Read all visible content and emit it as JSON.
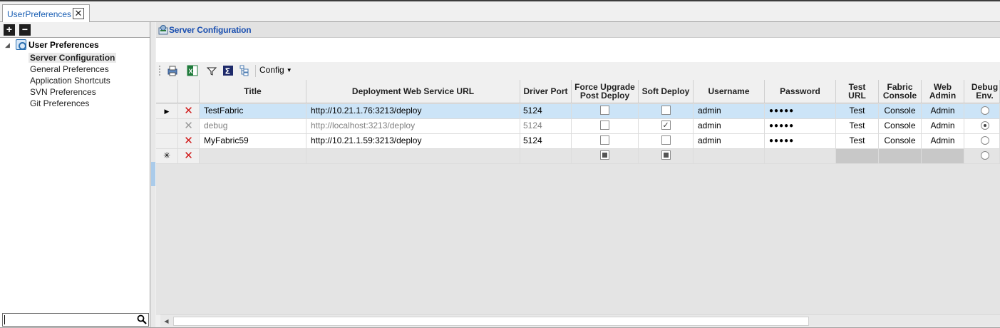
{
  "tab": {
    "label": "UserPreferences",
    "close_glyph": "✕"
  },
  "tree": {
    "expand_glyph": "+",
    "collapse_glyph": "−",
    "root_label": "User Preferences",
    "children": [
      "Server Configuration",
      "General Preferences",
      "Application Shortcuts",
      "SVN Preferences",
      "Git Preferences"
    ]
  },
  "search": {
    "value": ""
  },
  "panel": {
    "title": "Server Configuration"
  },
  "toolbar": {
    "config_label": "Config"
  },
  "grid": {
    "columns": {
      "title": "Title",
      "url": "Deployment Web Service URL",
      "driver_port": "Driver Port",
      "force_upgrade": "Force Upgrade Post Deploy",
      "soft_deploy": "Soft Deploy",
      "username": "Username",
      "password": "Password",
      "test_url": "Test URL",
      "fabric_console": "Fabric Console",
      "web_admin": "Web Admin",
      "debug_env": "Debug Env."
    },
    "rows": [
      {
        "title": "TestFabric",
        "url": "http://10.21.1.76:3213/deploy",
        "driver_port": "5124",
        "force_upgrade": false,
        "soft_deploy": false,
        "username": "admin",
        "password": "●●●●●",
        "test_url": "Test",
        "fabric_console": "Console",
        "web_admin": "Admin",
        "debug_env": false
      },
      {
        "title": "debug",
        "url": "http://localhost:3213/deploy",
        "driver_port": "5124",
        "force_upgrade": false,
        "soft_deploy": true,
        "username": "admin",
        "password": "●●●●●",
        "test_url": "Test",
        "fabric_console": "Console",
        "web_admin": "Admin",
        "debug_env": true
      },
      {
        "title": "MyFabric59",
        "url": "http://10.21.1.59:3213/deploy",
        "driver_port": "5124",
        "force_upgrade": false,
        "soft_deploy": false,
        "username": "admin",
        "password": "●●●●●",
        "test_url": "Test",
        "fabric_console": "Console",
        "web_admin": "Admin",
        "debug_env": false
      }
    ],
    "new_row_marker": "✳",
    "current_row_marker": "▶",
    "delete_glyph": "✕"
  },
  "colors": {
    "selection": "#cce4f7",
    "delete": "#d01818",
    "title_blue": "#1a4fb0"
  }
}
